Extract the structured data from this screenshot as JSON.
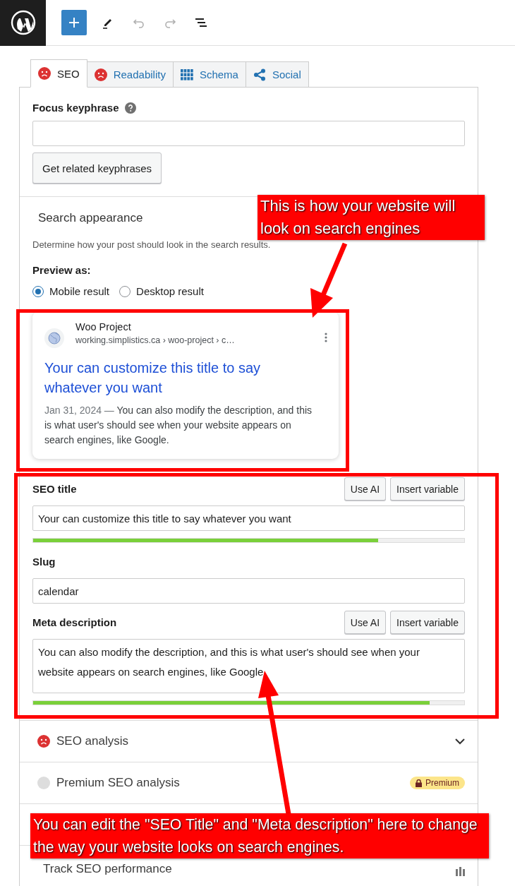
{
  "toolbar": {
    "buttons": [
      {
        "kind": "add",
        "disabled": false
      },
      {
        "kind": "edit",
        "disabled": false
      },
      {
        "kind": "undo",
        "disabled": true
      },
      {
        "kind": "redo",
        "disabled": true
      },
      {
        "kind": "outline",
        "disabled": false
      }
    ]
  },
  "tabs": [
    {
      "label": "SEO",
      "kind": "score",
      "selected": true
    },
    {
      "label": "Readability",
      "kind": "score",
      "selected": false
    },
    {
      "label": "Schema",
      "kind": "grid",
      "selected": false
    },
    {
      "label": "Social",
      "kind": "share",
      "selected": false
    }
  ],
  "focus_keyphrase": {
    "label": "Focus keyphrase",
    "button": "Get related keyphrases"
  },
  "search_appearance": {
    "title": "Search appearance",
    "description": "Determine how your post should look in the search results.",
    "preview_label": "Preview as:",
    "options": [
      {
        "label": "Mobile result",
        "selected": true
      },
      {
        "label": "Desktop result",
        "selected": false
      }
    ],
    "preview": {
      "site_name": "Woo Project",
      "breadcrumb": "working.simplistics.ca › woo-project › c…",
      "title": "Your can customize this title to say whatever you want",
      "date": "Jan 31, 2024",
      "separator": "—",
      "description": "You can also modify the description, and this is what user's should see when your website appears on search engines, like Google."
    },
    "fields": [
      {
        "kind": "input",
        "label": "SEO title",
        "buttons": [
          "Use AI",
          "Insert variable"
        ],
        "value": "Your can customize this title to say whatever you want",
        "level": 0.8
      },
      {
        "kind": "input",
        "label": "Slug",
        "value": "calendar"
      },
      {
        "kind": "textarea",
        "label": "Meta description",
        "buttons": [
          "Use AI",
          "Insert variable"
        ],
        "value": "You can also modify the description, and this is what user's should see when your website appears on search engines, like Google.",
        "level": 0.92
      }
    ]
  },
  "analysis": [
    {
      "kind": "analysis",
      "label": "SEO analysis"
    },
    {
      "kind": "premium",
      "label": "Premium SEO analysis",
      "badge": "Premium"
    },
    {
      "kind": "covered"
    },
    {
      "kind": "performance",
      "label": "Track SEO performance"
    }
  ],
  "annotations": [
    {
      "kind": "callout",
      "text": "This is how your website will look on search engines"
    },
    {
      "kind": "callout",
      "text": "You can edit the \"SEO Title\" and \"Meta description\" here to change the way your website looks on search engines."
    }
  ]
}
